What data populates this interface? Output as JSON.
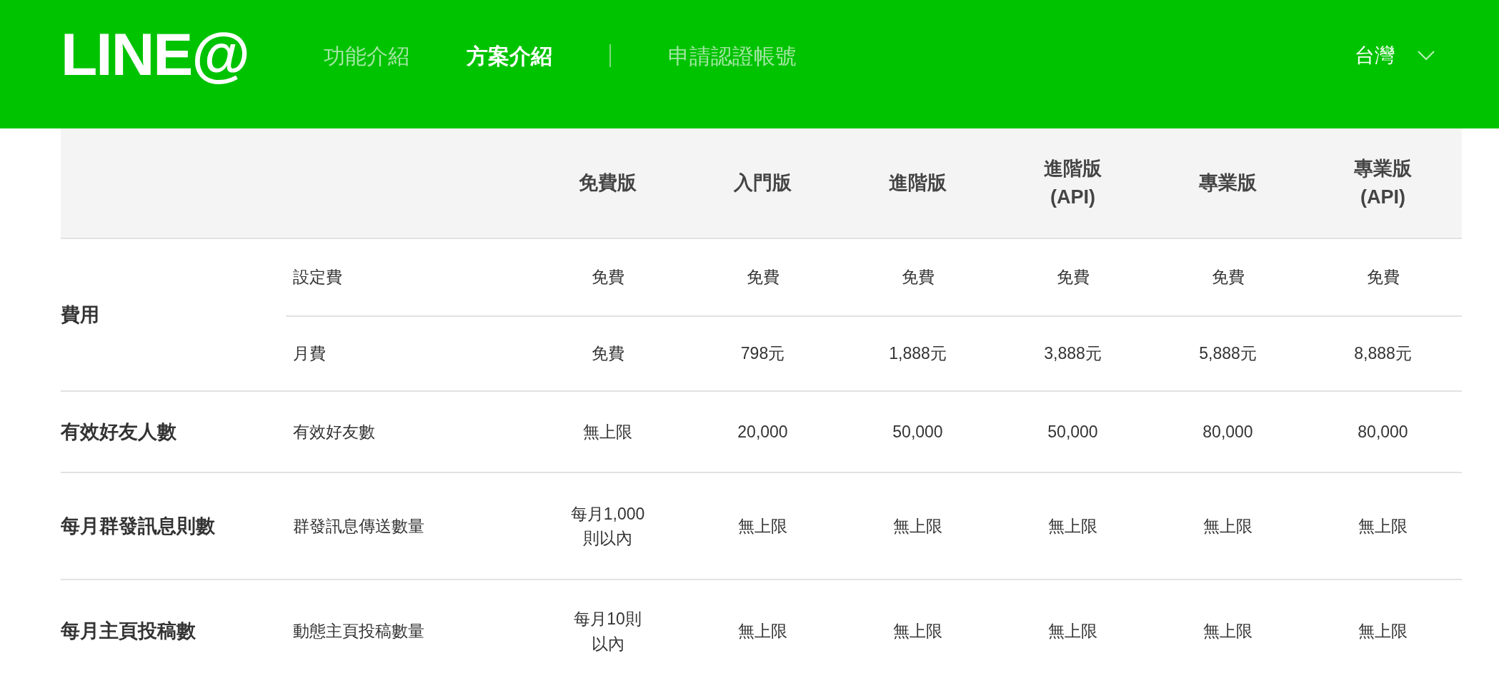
{
  "header": {
    "logo": "LINE@",
    "nav": [
      {
        "label": "功能介紹",
        "selected": false,
        "separator_before": false
      },
      {
        "label": "方案介紹",
        "selected": true,
        "separator_before": false
      },
      {
        "label": "申請認證帳號",
        "selected": false,
        "separator_before": true
      }
    ],
    "region": {
      "label": "台灣"
    }
  },
  "table": {
    "columns": [
      "免費版",
      "入門版",
      "進階版",
      "進階版\n(API)",
      "專業版",
      "專業版\n(API)"
    ],
    "groups": [
      {
        "category": "費用",
        "items": [
          {
            "label": "設定費",
            "values": [
              "免費",
              "免費",
              "免費",
              "免費",
              "免費",
              "免費"
            ]
          },
          {
            "label": "月費",
            "values": [
              "免費",
              "798元",
              "1,888元",
              "3,888元",
              "5,888元",
              "8,888元"
            ]
          }
        ]
      },
      {
        "category": "有效好友人數",
        "items": [
          {
            "label": "有效好友數",
            "values": [
              "無上限",
              "20,000",
              "50,000",
              "50,000",
              "80,000",
              "80,000"
            ]
          }
        ]
      },
      {
        "category": "每月群發訊息則數",
        "items": [
          {
            "label": "群發訊息傳送數量",
            "values": [
              "每月1,000則以內",
              "無上限",
              "無上限",
              "無上限",
              "無上限",
              "無上限"
            ]
          }
        ]
      },
      {
        "category": "每月主頁投稿數",
        "items": [
          {
            "label": "動態主頁投稿數量",
            "values": [
              "每月10則以內",
              "無上限",
              "無上限",
              "無上限",
              "無上限",
              "無上限"
            ]
          }
        ]
      }
    ]
  }
}
